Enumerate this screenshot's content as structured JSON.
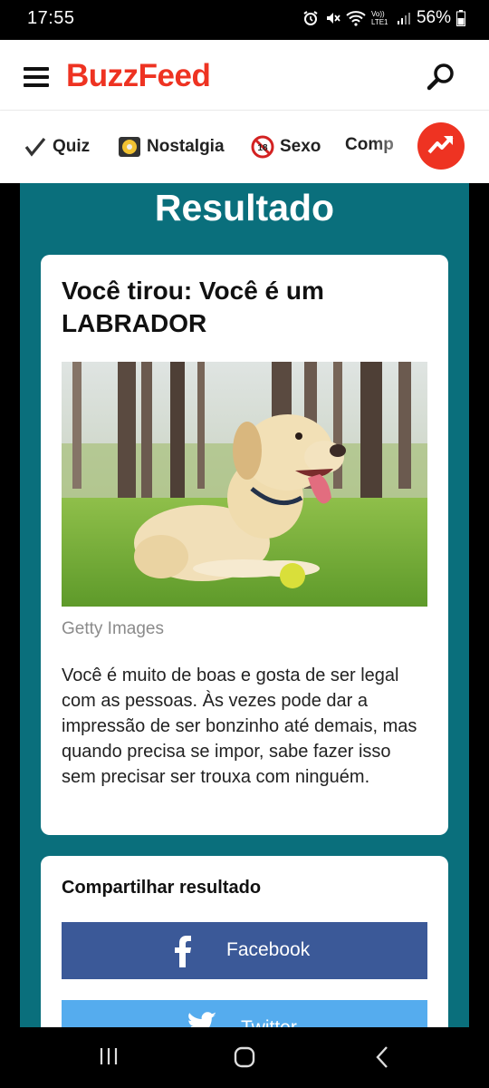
{
  "status_bar": {
    "time": "17:55",
    "network": "Vo)) LTE1",
    "battery": "56%",
    "icons": [
      "alarm-icon",
      "mute-icon",
      "wifi-icon",
      "signal-icon",
      "battery-icon"
    ]
  },
  "header": {
    "logo": "BuzzFeed",
    "icons": [
      "menu-icon",
      "search-icon"
    ]
  },
  "categories": [
    {
      "label": "Quiz",
      "icon": "checkmark-icon"
    },
    {
      "label": "Nostalgia",
      "icon": "cassette-icon"
    },
    {
      "label": "Sexo",
      "icon": "eighteen-plus-icon"
    },
    {
      "label": "Comp",
      "icon": ""
    }
  ],
  "trending_icon": "trending-icon",
  "result": {
    "heading": "Resultado",
    "title": "Você tirou: Você é um LABRADOR",
    "image_alt": "labrador-dog-photo",
    "image_credit": "Getty Images",
    "description": "Você é muito de boas e gosta de ser legal com as pessoas. Às vezes pode dar a impressão de ser bonzinho até demais, mas quando precisa se impor, sabe fazer isso sem precisar ser trouxa com ninguém."
  },
  "share": {
    "title": "Compartilhar resultado",
    "facebook_label": "Facebook",
    "twitter_label": "Twitter"
  },
  "colors": {
    "brand": "#ee3322",
    "teal": "#0a6f7c",
    "facebook": "#3b5998",
    "twitter": "#55acee"
  },
  "nav_bar": {
    "icons": [
      "recent-apps-icon",
      "home-icon",
      "back-icon"
    ]
  }
}
